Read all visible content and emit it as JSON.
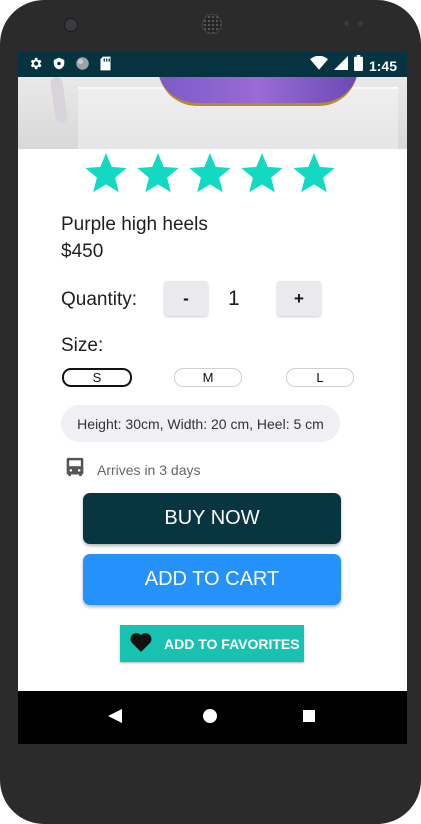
{
  "status_bar": {
    "time": "1:45",
    "left_icons": [
      "gear-icon",
      "shield-icon",
      "circle-icon",
      "sd-card-icon"
    ],
    "right_icons": [
      "wifi-icon",
      "signal-icon",
      "battery-icon"
    ]
  },
  "carousel": {
    "image": "purple-sunglasses-product-image",
    "page_count": 3,
    "active_page": 1
  },
  "rating": {
    "stars_filled": 5,
    "stars_total": 5,
    "color": "#12d9c1"
  },
  "product": {
    "name": "Purple high heels",
    "price": "$450"
  },
  "quantity": {
    "label": "Quantity:",
    "minus_label": "-",
    "value": "1",
    "plus_label": "+"
  },
  "size": {
    "label": "Size:",
    "options": [
      "S",
      "M",
      "L"
    ],
    "selected": "S"
  },
  "dimensions": "Height: 30cm, Width: 20 cm, Heel: 5 cm",
  "shipping": {
    "icon": "bus-icon",
    "text": "Arrives in 3 days"
  },
  "actions": {
    "buy_now": "BUY NOW",
    "add_to_cart": "ADD TO CART",
    "add_to_favorites": "ADD TO FAVORITES"
  },
  "colors": {
    "status_bar": "#063340",
    "buy_now": "#073540",
    "add_to_cart": "#2591fb",
    "favorites": "#19c1b1"
  },
  "nav_bar": [
    "back-icon",
    "home-icon",
    "recents-icon"
  ]
}
